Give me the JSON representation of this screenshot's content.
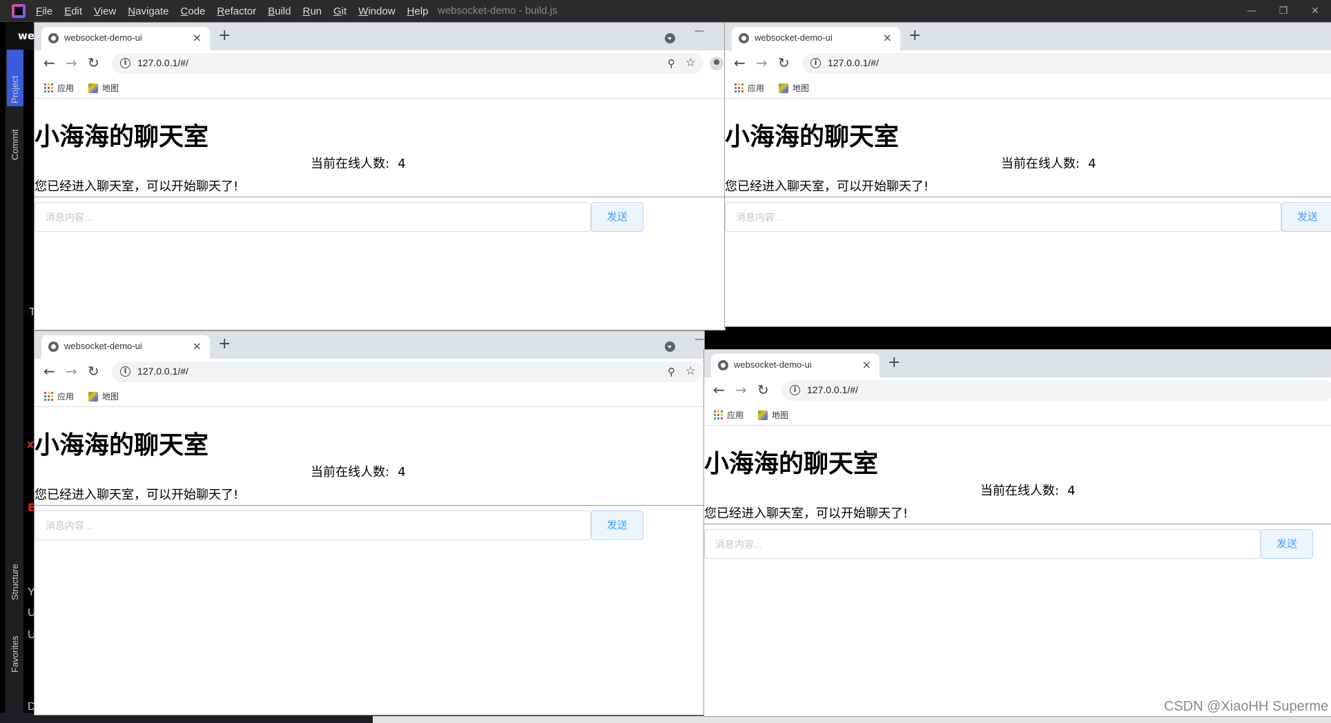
{
  "ide": {
    "menu": [
      "File",
      "Edit",
      "View",
      "Navigate",
      "Code",
      "Refactor",
      "Build",
      "Run",
      "Git",
      "Window",
      "Help"
    ],
    "title": "websocket-demo - build.js",
    "top_tab": "we",
    "side_tabs": {
      "project": "Project",
      "commit": "Commit",
      "structure": "Structure",
      "favorites": "Favorites"
    },
    "ghost_letters": [
      "T",
      "Y",
      "U",
      "U",
      "D"
    ],
    "window_controls": {
      "minimize": "—",
      "restore": "❐",
      "close": "✕"
    }
  },
  "browser": {
    "tab_title": "websocket-demo-ui",
    "new_tab": "+",
    "tab_close": "×",
    "url": "127.0.0.1/#/",
    "bookmarks": {
      "apps": "应用",
      "maps": "地图"
    },
    "nav": {
      "back": "←",
      "forward": "→",
      "reload": "↻"
    },
    "minimize": "—"
  },
  "chat": {
    "title": "小海海的聊天室",
    "online_label": "当前在线人数:",
    "online_count": "4",
    "welcome": "您已经进入聊天室，可以开始聊天了!",
    "input_placeholder": "消息内容...",
    "send_label": "发送"
  },
  "red_marks": [
    "x",
    "E"
  ],
  "watermark": "CSDN @XiaoHH Superme",
  "colors": {
    "ide_bg": "#2b2b2b",
    "chrome_tabstrip": "#dee1e6",
    "send_button_text": "#409eff",
    "send_button_bg": "#ecf5ff"
  }
}
